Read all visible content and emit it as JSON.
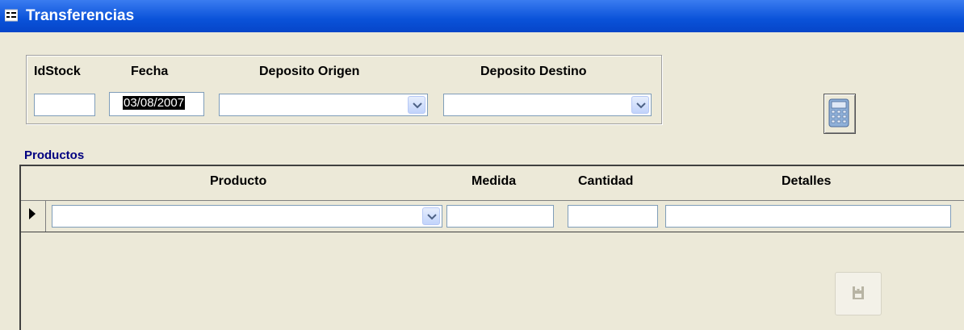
{
  "window": {
    "title": "Transferencias",
    "icon": "form-icon"
  },
  "header_fields": {
    "idstock_label": "IdStock",
    "idstock_value": "",
    "fecha_label": "Fecha",
    "fecha_value": "03/08/2007",
    "deposito_origen_label": "Deposito Origen",
    "deposito_origen_value": "",
    "deposito_destino_label": "Deposito Destino",
    "deposito_destino_value": ""
  },
  "buttons": {
    "calculator": "calculator-icon",
    "save": "save-icon"
  },
  "productos": {
    "title": "Productos",
    "columns": [
      "Producto",
      "Medida",
      "Cantidad",
      "Detalles"
    ],
    "rows": [
      {
        "producto": "",
        "medida": "",
        "cantidad": "",
        "detalles": ""
      }
    ]
  },
  "colors": {
    "titlebar": "#0a52d9",
    "background": "#ece9d8",
    "section_title": "#000080",
    "field_border": "#7f9db9"
  }
}
